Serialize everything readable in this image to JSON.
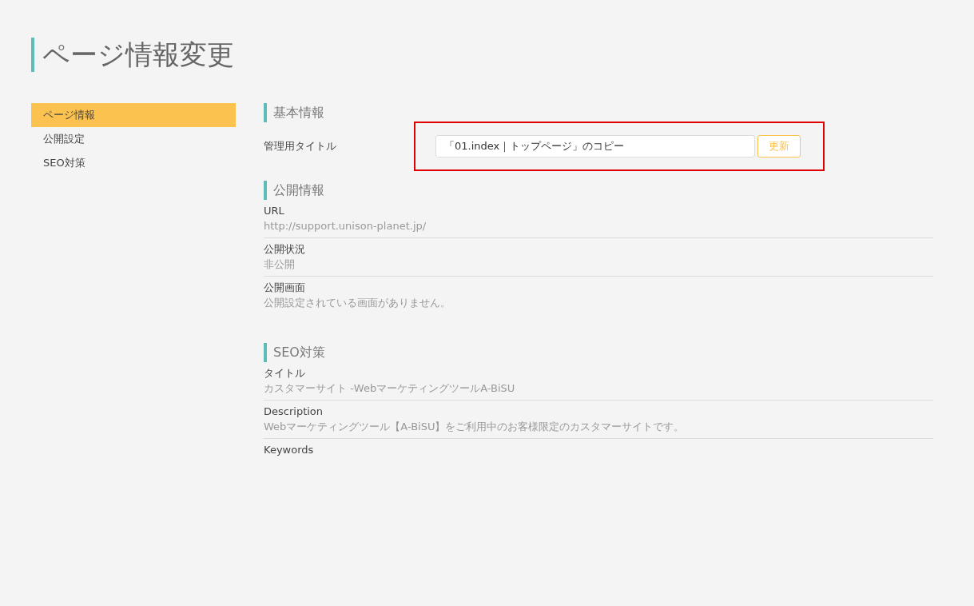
{
  "page_title": "ページ情報変更",
  "sidebar": {
    "items": [
      {
        "label": "ページ情報",
        "selected": true
      },
      {
        "label": "公開設定",
        "selected": false
      },
      {
        "label": "SEO対策",
        "selected": false
      }
    ]
  },
  "basic": {
    "heading": "基本情報",
    "field_label": "管理用タイトル",
    "field_value": "「01.index｜トップページ」のコピー",
    "button": "更新",
    "highlighted": true
  },
  "sections": [
    {
      "heading": "公開情報",
      "rows": [
        {
          "label": "URL",
          "value": "http://support.unison-planet.jp/"
        },
        {
          "label": "公開状況",
          "value": "非公開"
        },
        {
          "label": "公開画面",
          "value": "公開設定されている画面がありません。"
        }
      ]
    },
    {
      "heading": "SEO対策",
      "rows": [
        {
          "label": "タイトル",
          "value": "カスタマーサイト -WebマーケティングツールA-BiSU"
        },
        {
          "label": "Description",
          "value": "Webマーケティングツール【A-BiSU】をご利用中のお客様限定のカスタマーサイトです。"
        },
        {
          "label": "Keywords"
        }
      ]
    }
  ]
}
